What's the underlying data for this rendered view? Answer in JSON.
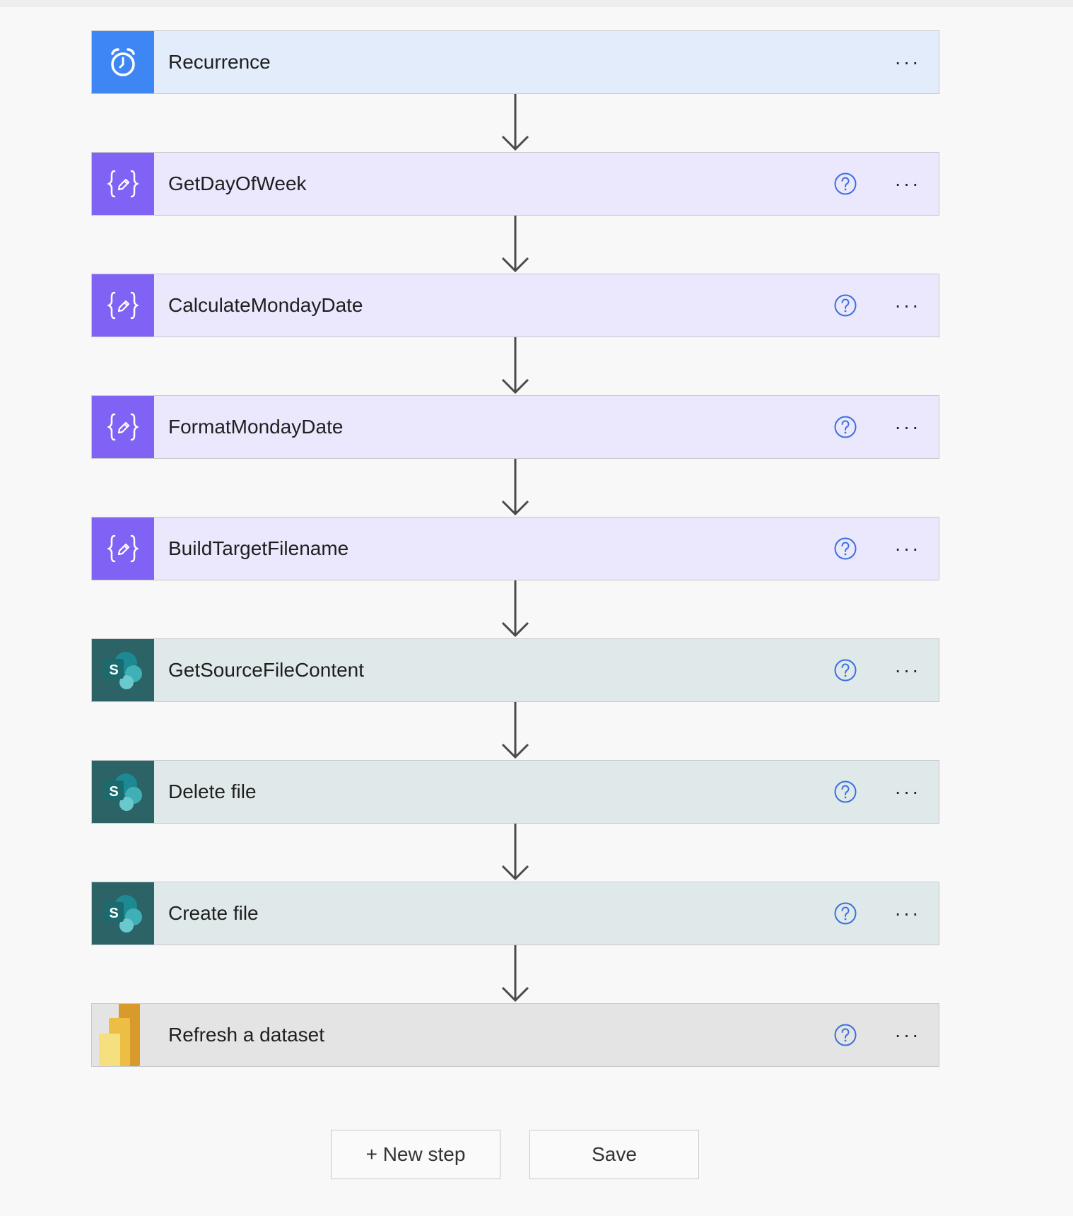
{
  "steps": [
    {
      "title": "Recurrence",
      "icon": "alarm-clock-icon",
      "kind": "recurrence",
      "bg": "#e2ecfb",
      "icon_bg": "#3f86f5",
      "has_help": false
    },
    {
      "title": "GetDayOfWeek",
      "icon": "variable-edit-icon",
      "kind": "variable",
      "bg": "#ebe7fd",
      "icon_bg": "#8062f5",
      "has_help": true
    },
    {
      "title": "CalculateMondayDate",
      "icon": "variable-edit-icon",
      "kind": "variable",
      "bg": "#ebe7fd",
      "icon_bg": "#8062f5",
      "has_help": true
    },
    {
      "title": "FormatMondayDate",
      "icon": "variable-edit-icon",
      "kind": "variable",
      "bg": "#ebe7fd",
      "icon_bg": "#8062f5",
      "has_help": true
    },
    {
      "title": "BuildTargetFilename",
      "icon": "variable-edit-icon",
      "kind": "variable",
      "bg": "#ebe7fd",
      "icon_bg": "#8062f5",
      "has_help": true
    },
    {
      "title": "GetSourceFileContent",
      "icon": "sharepoint-icon",
      "kind": "sharepoint",
      "bg": "#e0e9ea",
      "icon_bg": "#2b6366",
      "has_help": true
    },
    {
      "title": "Delete file",
      "icon": "sharepoint-icon",
      "kind": "sharepoint",
      "bg": "#e0e9ea",
      "icon_bg": "#2b6366",
      "has_help": true
    },
    {
      "title": "Create file",
      "icon": "sharepoint-icon",
      "kind": "sharepoint",
      "bg": "#e0e9ea",
      "icon_bg": "#2b6366",
      "has_help": true
    },
    {
      "title": "Refresh a dataset",
      "icon": "power-bi-icon",
      "kind": "powerbi",
      "bg": "#e4e4e4",
      "icon_bg": "#e4e4e4",
      "has_help": true
    }
  ],
  "more_label": "···",
  "buttons": {
    "new_step": "+ New step",
    "save": "Save"
  },
  "colors": {
    "help_icon": "#3a6fe0",
    "arrow": "#4a4a4a"
  }
}
